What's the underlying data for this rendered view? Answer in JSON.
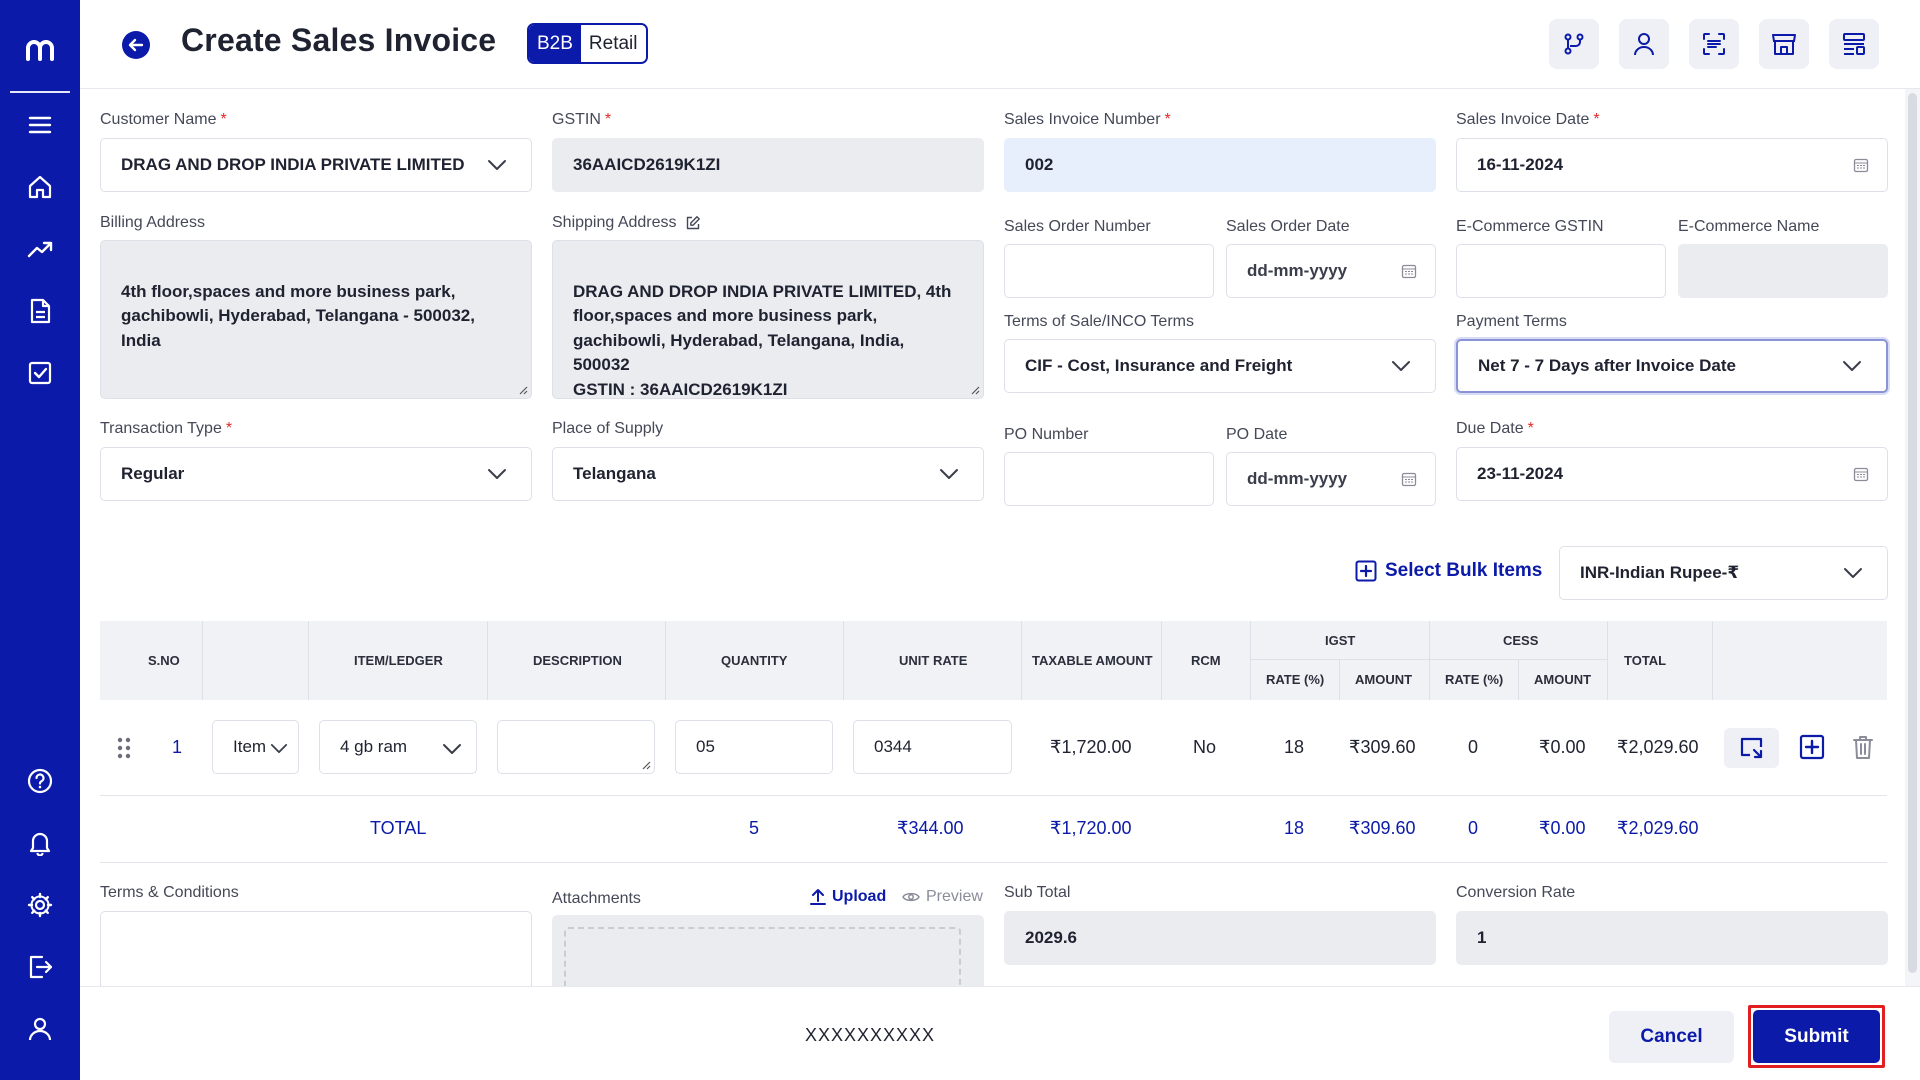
{
  "header": {
    "title": "Create Sales Invoice",
    "toggle": {
      "b2b": "B2B",
      "retail": "Retail"
    }
  },
  "form": {
    "customer_name": {
      "label": "Customer Name",
      "value": "DRAG AND DROP INDIA PRIVATE LIMITED"
    },
    "gstin": {
      "label": "GSTIN",
      "value": "36AAICD2619K1ZI"
    },
    "invoice_number": {
      "label": "Sales Invoice Number",
      "value": "002"
    },
    "invoice_date": {
      "label": "Sales Invoice Date",
      "value": "16-11-2024"
    },
    "billing_address": {
      "label": "Billing Address",
      "value": "4th floor,spaces and more business park,\ngachibowli, Hyderabad, Telangana - 500032,\nIndia"
    },
    "shipping_address": {
      "label": "Shipping Address",
      "value": "DRAG AND DROP INDIA PRIVATE LIMITED, 4th\nfloor,spaces and more business park,\ngachibowli, Hyderabad, Telangana, India,\n500032\nGSTIN : 36AAICD2619K1ZI"
    },
    "sales_order_number": {
      "label": "Sales Order Number",
      "value": ""
    },
    "sales_order_date": {
      "label": "Sales Order Date",
      "placeholder": "dd-mm-yyyy"
    },
    "ecommerce_gstin": {
      "label": "E-Commerce GSTIN",
      "value": ""
    },
    "ecommerce_name": {
      "label": "E-Commerce Name",
      "value": ""
    },
    "terms_of_sale": {
      "label": "Terms of Sale/INCO Terms",
      "value": "CIF - Cost, Insurance and Freight"
    },
    "payment_terms": {
      "label": "Payment Terms",
      "value": "Net 7 - 7 Days after Invoice Date"
    },
    "transaction_type": {
      "label": "Transaction Type",
      "value": "Regular"
    },
    "place_of_supply": {
      "label": "Place of Supply",
      "value": "Telangana"
    },
    "po_number": {
      "label": "PO Number",
      "value": ""
    },
    "po_date": {
      "label": "PO Date",
      "placeholder": "dd-mm-yyyy"
    },
    "due_date": {
      "label": "Due Date",
      "value": "23-11-2024"
    }
  },
  "bulk": {
    "label": "Select Bulk Items"
  },
  "currency": {
    "value": "INR-Indian Rupee-₹"
  },
  "table": {
    "headers": {
      "sno": "S.NO",
      "item_ledger": "ITEM/LEDGER",
      "description": "DESCRIPTION",
      "quantity": "QUANTITY",
      "unit_rate": "UNIT RATE",
      "taxable_amount": "TAXABLE AMOUNT",
      "rcm": "RCM",
      "igst": "IGST",
      "cess": "CESS",
      "rate": "RATE (%)",
      "amount": "AMOUNT",
      "total": "TOTAL"
    },
    "row": {
      "sno": "1",
      "type": "Item",
      "item": "4 gb ram",
      "description": "",
      "quantity": "05",
      "unit_rate": "0344",
      "taxable_amount": "₹1,720.00",
      "rcm": "No",
      "igst_rate": "18",
      "igst_amount": "₹309.60",
      "cess_rate": "0",
      "cess_amount": "₹0.00",
      "total": "₹2,029.60"
    },
    "totals": {
      "label": "TOTAL",
      "quantity": "5",
      "unit_rate": "₹344.00",
      "taxable_amount": "₹1,720.00",
      "igst_rate": "18",
      "igst_amount": "₹309.60",
      "cess_rate": "0",
      "cess_amount": "₹0.00",
      "total": "₹2,029.60"
    }
  },
  "bottom": {
    "terms_label": "Terms & Conditions",
    "attachments_label": "Attachments",
    "upload": "Upload",
    "preview": "Preview",
    "sub_total": {
      "label": "Sub Total",
      "value": "2029.6"
    },
    "conversion_rate": {
      "label": "Conversion Rate",
      "value": "1"
    }
  },
  "footer": {
    "text": "XXXXXXXXXX",
    "cancel": "Cancel",
    "submit": "Submit"
  },
  "colors": {
    "brand": "#0b1aa8",
    "required": "#e02b2b",
    "highlight": "#e02020"
  }
}
